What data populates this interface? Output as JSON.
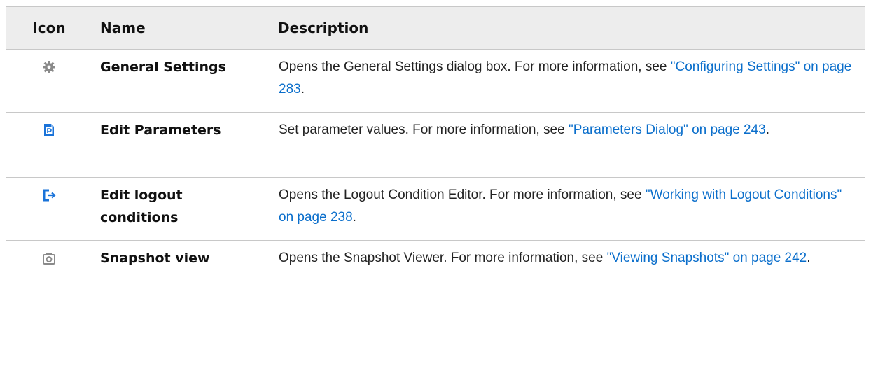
{
  "header": {
    "icon": "Icon",
    "name": "Name",
    "description": "Description"
  },
  "rows": [
    {
      "icon": "gear-icon",
      "name": "General Settings",
      "desc_text": "Opens the General Settings dialog box. For more information, see ",
      "link": "\"Configuring Settings\" on page 283",
      "trail": "."
    },
    {
      "icon": "edit-parameters-icon",
      "name": "Edit Parameters",
      "desc_text": "Set parameter values. For more information, see ",
      "link": "\"Parameters Dialog\" on page 243",
      "trail": "."
    },
    {
      "icon": "logout-icon",
      "name": "Edit logout conditions",
      "desc_text": "Opens the Logout Condition Editor. For more information, see ",
      "link": "\"Working with Logout Conditions\" on page 238",
      "trail": "."
    },
    {
      "icon": "camera-icon",
      "name": "Snapshot view",
      "desc_text": "Opens the Snapshot Viewer. For more information, see ",
      "link": "\"Viewing Snapshots\" on page 242",
      "trail": "."
    }
  ],
  "colors": {
    "link": "#0a6ecb",
    "header_bg": "#ededed",
    "icon_gray": "#8a8a8a",
    "icon_blue": "#1a73d9"
  }
}
